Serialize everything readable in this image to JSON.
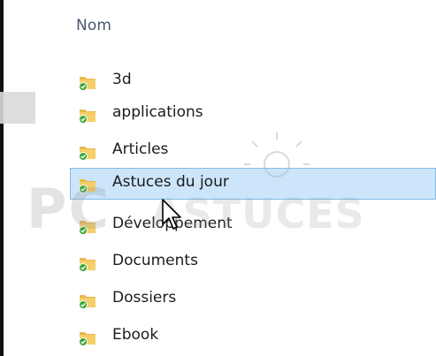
{
  "column_header": "Nom",
  "folders": [
    {
      "name": "3d",
      "selected": false
    },
    {
      "name": "applications",
      "selected": false
    },
    {
      "name": "Articles",
      "selected": false
    },
    {
      "name": "Astuces du jour",
      "selected": true
    },
    {
      "name": "Développement",
      "selected": false
    },
    {
      "name": "Documents",
      "selected": false
    },
    {
      "name": "Dossiers",
      "selected": false
    },
    {
      "name": "Ebook",
      "selected": false
    }
  ],
  "watermark": {
    "text": "PC ASTUCES"
  },
  "colors": {
    "selection_bg": "#cce5fb",
    "selection_border": "#7fbbe9",
    "folder": "#e8b84a",
    "sync_badge": "#3aa535"
  },
  "icons": {
    "folder": "folder-icon",
    "sync": "sync-check-icon",
    "cursor": "mouse-cursor-icon"
  }
}
